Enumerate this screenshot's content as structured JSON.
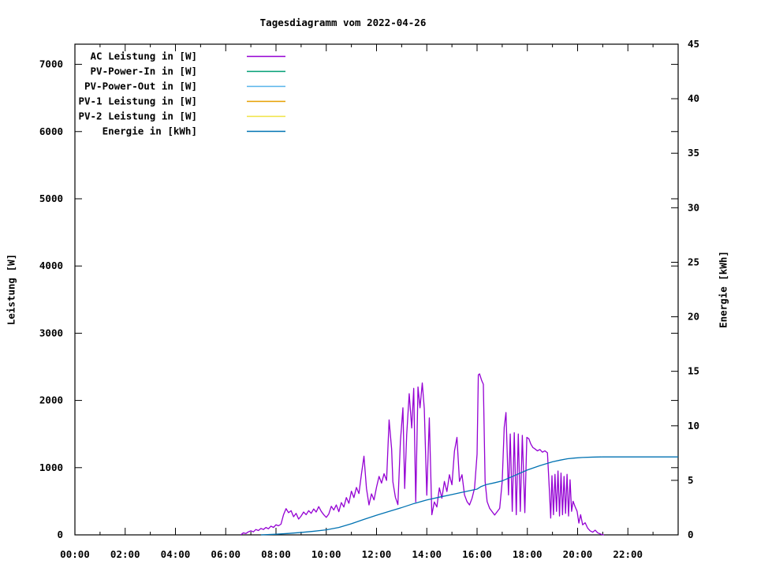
{
  "chart_data": {
    "type": "line",
    "title": "Tagesdiagramm vom 2022-04-26",
    "ylabel": "Leistung [W]",
    "y2label": "Energie [kWh]",
    "background": "#ffffff",
    "axis_color": "#000000",
    "grid": false,
    "legend_position": "top-left-inside",
    "x_axis": {
      "range_hours": [
        0,
        24
      ],
      "major_ticks": [
        {
          "h": 0,
          "label": "00:00"
        },
        {
          "h": 2,
          "label": "02:00"
        },
        {
          "h": 4,
          "label": "04:00"
        },
        {
          "h": 6,
          "label": "06:00"
        },
        {
          "h": 8,
          "label": "08:00"
        },
        {
          "h": 10,
          "label": "10:00"
        },
        {
          "h": 12,
          "label": "12:00"
        },
        {
          "h": 14,
          "label": "14:00"
        },
        {
          "h": 16,
          "label": "16:00"
        },
        {
          "h": 18,
          "label": "18:00"
        },
        {
          "h": 20,
          "label": "20:00"
        },
        {
          "h": 22,
          "label": "22:00"
        }
      ],
      "minor_tick_hours": [
        1,
        3,
        5,
        7,
        9,
        11,
        13,
        15,
        17,
        19,
        21,
        23
      ]
    },
    "y_axis": {
      "label": "Leistung [W]",
      "range": [
        0,
        7300
      ],
      "ticks": [
        0,
        1000,
        2000,
        3000,
        4000,
        5000,
        6000,
        7000
      ]
    },
    "y2_axis": {
      "label": "Energie [kWh]",
      "range": [
        0,
        45
      ],
      "ticks": [
        0,
        5,
        10,
        15,
        20,
        25,
        30,
        35,
        40,
        45
      ]
    },
    "series": [
      {
        "name": "AC Leistung in [W]",
        "color": "#9400d3",
        "axis": "y",
        "points": [
          [
            6.6,
            0
          ],
          [
            6.7,
            30
          ],
          [
            6.8,
            20
          ],
          [
            6.9,
            45
          ],
          [
            7.0,
            60
          ],
          [
            7.1,
            45
          ],
          [
            7.2,
            80
          ],
          [
            7.3,
            65
          ],
          [
            7.4,
            95
          ],
          [
            7.5,
            80
          ],
          [
            7.6,
            110
          ],
          [
            7.7,
            90
          ],
          [
            7.8,
            130
          ],
          [
            7.9,
            110
          ],
          [
            8.0,
            150
          ],
          [
            8.1,
            135
          ],
          [
            8.2,
            160
          ],
          [
            8.3,
            300
          ],
          [
            8.4,
            390
          ],
          [
            8.5,
            330
          ],
          [
            8.6,
            360
          ],
          [
            8.7,
            270
          ],
          [
            8.8,
            320
          ],
          [
            8.9,
            235
          ],
          [
            9.0,
            280
          ],
          [
            9.1,
            340
          ],
          [
            9.2,
            300
          ],
          [
            9.3,
            360
          ],
          [
            9.4,
            320
          ],
          [
            9.5,
            385
          ],
          [
            9.6,
            340
          ],
          [
            9.7,
            420
          ],
          [
            9.8,
            350
          ],
          [
            9.9,
            300
          ],
          [
            10.0,
            260
          ],
          [
            10.1,
            310
          ],
          [
            10.2,
            425
          ],
          [
            10.3,
            370
          ],
          [
            10.4,
            445
          ],
          [
            10.5,
            345
          ],
          [
            10.6,
            480
          ],
          [
            10.7,
            415
          ],
          [
            10.8,
            555
          ],
          [
            10.9,
            470
          ],
          [
            11.0,
            650
          ],
          [
            11.1,
            555
          ],
          [
            11.2,
            705
          ],
          [
            11.3,
            615
          ],
          [
            11.4,
            905
          ],
          [
            11.5,
            1170
          ],
          [
            11.6,
            690
          ],
          [
            11.7,
            445
          ],
          [
            11.8,
            610
          ],
          [
            11.9,
            520
          ],
          [
            12.0,
            710
          ],
          [
            12.1,
            870
          ],
          [
            12.2,
            770
          ],
          [
            12.3,
            910
          ],
          [
            12.4,
            810
          ],
          [
            12.5,
            1710
          ],
          [
            12.6,
            1280
          ],
          [
            12.65,
            790
          ],
          [
            12.75,
            560
          ],
          [
            12.85,
            450
          ],
          [
            12.95,
            1390
          ],
          [
            13.05,
            1890
          ],
          [
            13.12,
            690
          ],
          [
            13.2,
            1490
          ],
          [
            13.3,
            2100
          ],
          [
            13.4,
            1590
          ],
          [
            13.48,
            2180
          ],
          [
            13.56,
            490
          ],
          [
            13.65,
            2200
          ],
          [
            13.73,
            1890
          ],
          [
            13.82,
            2260
          ],
          [
            13.9,
            1880
          ],
          [
            14.0,
            590
          ],
          [
            14.1,
            1740
          ],
          [
            14.2,
            300
          ],
          [
            14.3,
            490
          ],
          [
            14.4,
            415
          ],
          [
            14.5,
            700
          ],
          [
            14.6,
            545
          ],
          [
            14.7,
            795
          ],
          [
            14.8,
            645
          ],
          [
            14.9,
            895
          ],
          [
            15.0,
            745
          ],
          [
            15.1,
            1245
          ],
          [
            15.2,
            1450
          ],
          [
            15.3,
            795
          ],
          [
            15.4,
            895
          ],
          [
            15.5,
            595
          ],
          [
            15.6,
            495
          ],
          [
            15.7,
            445
          ],
          [
            15.8,
            545
          ],
          [
            15.9,
            695
          ],
          [
            16.0,
            1200
          ],
          [
            16.05,
            2380
          ],
          [
            16.1,
            2395
          ],
          [
            16.18,
            2300
          ],
          [
            16.25,
            2240
          ],
          [
            16.32,
            795
          ],
          [
            16.4,
            495
          ],
          [
            16.5,
            395
          ],
          [
            16.6,
            345
          ],
          [
            16.7,
            295
          ],
          [
            16.8,
            345
          ],
          [
            16.9,
            395
          ],
          [
            17.0,
            795
          ],
          [
            17.08,
            1600
          ],
          [
            17.15,
            1820
          ],
          [
            17.25,
            595
          ],
          [
            17.32,
            1500
          ],
          [
            17.4,
            350
          ],
          [
            17.48,
            1520
          ],
          [
            17.56,
            300
          ],
          [
            17.64,
            1500
          ],
          [
            17.72,
            350
          ],
          [
            17.8,
            1480
          ],
          [
            17.9,
            330
          ],
          [
            17.98,
            1450
          ],
          [
            18.06,
            1430
          ],
          [
            18.14,
            1350
          ],
          [
            18.22,
            1300
          ],
          [
            18.3,
            1280
          ],
          [
            18.4,
            1250
          ],
          [
            18.5,
            1270
          ],
          [
            18.6,
            1230
          ],
          [
            18.7,
            1250
          ],
          [
            18.8,
            1220
          ],
          [
            18.87,
            715
          ],
          [
            18.93,
            250
          ],
          [
            18.98,
            880
          ],
          [
            19.04,
            300
          ],
          [
            19.1,
            900
          ],
          [
            19.16,
            350
          ],
          [
            19.22,
            950
          ],
          [
            19.28,
            280
          ],
          [
            19.34,
            920
          ],
          [
            19.4,
            300
          ],
          [
            19.46,
            870
          ],
          [
            19.52,
            320
          ],
          [
            19.58,
            900
          ],
          [
            19.64,
            280
          ],
          [
            19.7,
            820
          ],
          [
            19.76,
            350
          ],
          [
            19.82,
            500
          ],
          [
            19.9,
            420
          ],
          [
            19.98,
            350
          ],
          [
            20.05,
            175
          ],
          [
            20.12,
            300
          ],
          [
            20.2,
            150
          ],
          [
            20.3,
            180
          ],
          [
            20.4,
            100
          ],
          [
            20.5,
            60
          ],
          [
            20.6,
            40
          ],
          [
            20.7,
            70
          ],
          [
            20.8,
            30
          ],
          [
            20.9,
            15
          ],
          [
            21.0,
            0
          ],
          [
            21.05,
            0
          ]
        ]
      },
      {
        "name": "PV-Power-In in [W]",
        "color": "#009e73",
        "axis": "y",
        "points": []
      },
      {
        "name": "PV-Power-Out in [W]",
        "color": "#56b4e9",
        "axis": "y",
        "points": []
      },
      {
        "name": "PV-1 Leistung in [W]",
        "color": "#e69f00",
        "axis": "y",
        "points": []
      },
      {
        "name": "PV-2 Leistung in [W]",
        "color": "#f0e442",
        "axis": "y",
        "points": []
      },
      {
        "name": "Energie in [kWh]",
        "color": "#0072b2",
        "axis": "y2",
        "points": [
          [
            7.4,
            0
          ],
          [
            8.0,
            0.06
          ],
          [
            8.5,
            0.13
          ],
          [
            9.0,
            0.22
          ],
          [
            9.5,
            0.33
          ],
          [
            10.0,
            0.46
          ],
          [
            10.5,
            0.68
          ],
          [
            11.0,
            1.02
          ],
          [
            11.5,
            1.42
          ],
          [
            12.0,
            1.8
          ],
          [
            12.5,
            2.15
          ],
          [
            13.0,
            2.5
          ],
          [
            13.5,
            2.88
          ],
          [
            14.0,
            3.2
          ],
          [
            14.5,
            3.46
          ],
          [
            15.0,
            3.7
          ],
          [
            15.5,
            3.95
          ],
          [
            16.0,
            4.2
          ],
          [
            16.15,
            4.42
          ],
          [
            16.35,
            4.6
          ],
          [
            16.7,
            4.78
          ],
          [
            17.0,
            4.95
          ],
          [
            17.5,
            5.45
          ],
          [
            18.0,
            5.95
          ],
          [
            18.5,
            6.35
          ],
          [
            19.0,
            6.7
          ],
          [
            19.3,
            6.85
          ],
          [
            19.6,
            6.98
          ],
          [
            19.9,
            7.05
          ],
          [
            20.2,
            7.1
          ],
          [
            20.6,
            7.13
          ],
          [
            21.0,
            7.15
          ],
          [
            22.0,
            7.15
          ],
          [
            23.0,
            7.15
          ],
          [
            24.0,
            7.15
          ]
        ]
      }
    ]
  }
}
